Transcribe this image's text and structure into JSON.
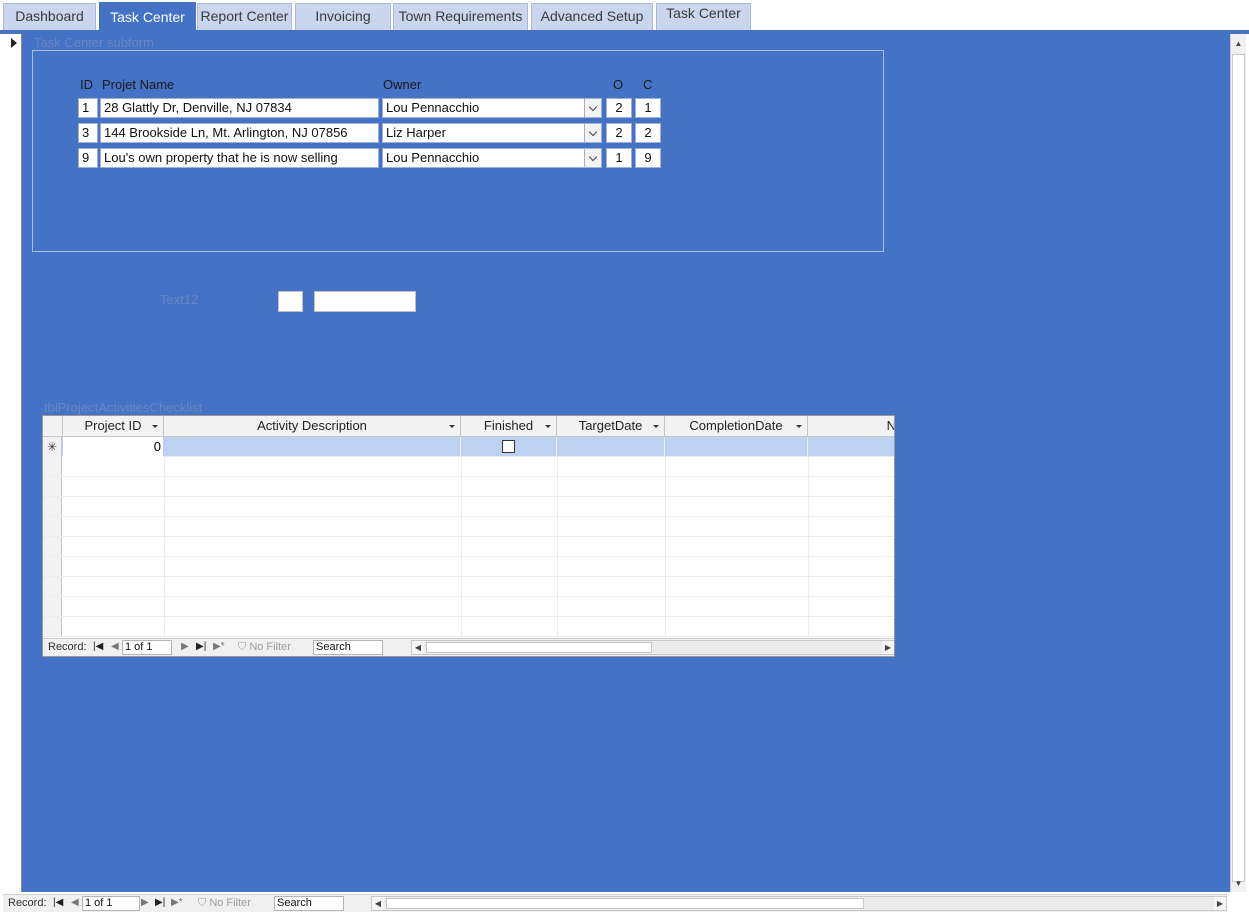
{
  "tabs": [
    {
      "label": "Dashboard",
      "active": false
    },
    {
      "label": "Task Center",
      "active": true
    },
    {
      "label": "Report Center",
      "active": false
    },
    {
      "label": "Invoicing",
      "active": false
    },
    {
      "label": "Town Requirements",
      "active": false
    },
    {
      "label": "Advanced Setup",
      "active": false
    },
    {
      "label": "Task Center",
      "active": false
    }
  ],
  "subform": {
    "label": "Task Center subform",
    "headers": {
      "id": "ID",
      "name": "Projet Name",
      "owner": "Owner",
      "o": "O",
      "c": "C"
    },
    "rows": [
      {
        "id": "1",
        "name": "28 Glattly Dr, Denville, NJ 07834",
        "owner": "Lou Pennacchio",
        "o": "2",
        "c": "1"
      },
      {
        "id": "3",
        "name": "144 Brookside Ln, Mt. Arlington, NJ 07856",
        "owner": "Liz Harper",
        "o": "2",
        "c": "2"
      },
      {
        "id": "9",
        "name": "Lou's own property that he is now selling",
        "owner": "Lou Pennacchio",
        "o": "1",
        "c": "9"
      }
    ]
  },
  "text12": {
    "label": "Text12",
    "value_small": "",
    "value_wide": ""
  },
  "checklist": {
    "label": "tblProjectActivitiesChecklist",
    "columns": [
      "Project ID",
      "Activity Description",
      "Finished",
      "TargetDate",
      "CompletionDate",
      "N"
    ],
    "new_row": {
      "selector": "✳",
      "project_id": "0",
      "finished": false
    },
    "nav": {
      "record_label": "Record:",
      "position": "1 of 1",
      "filter": "No Filter",
      "search": "Search"
    }
  },
  "form_nav": {
    "record_label": "Record:",
    "position": "1 of 1",
    "filter": "No Filter",
    "search": "Search"
  },
  "colors": {
    "canvas": "#4472c4",
    "tab_inactive": "#c9d6ee",
    "new_row": "#bcd2f0"
  }
}
